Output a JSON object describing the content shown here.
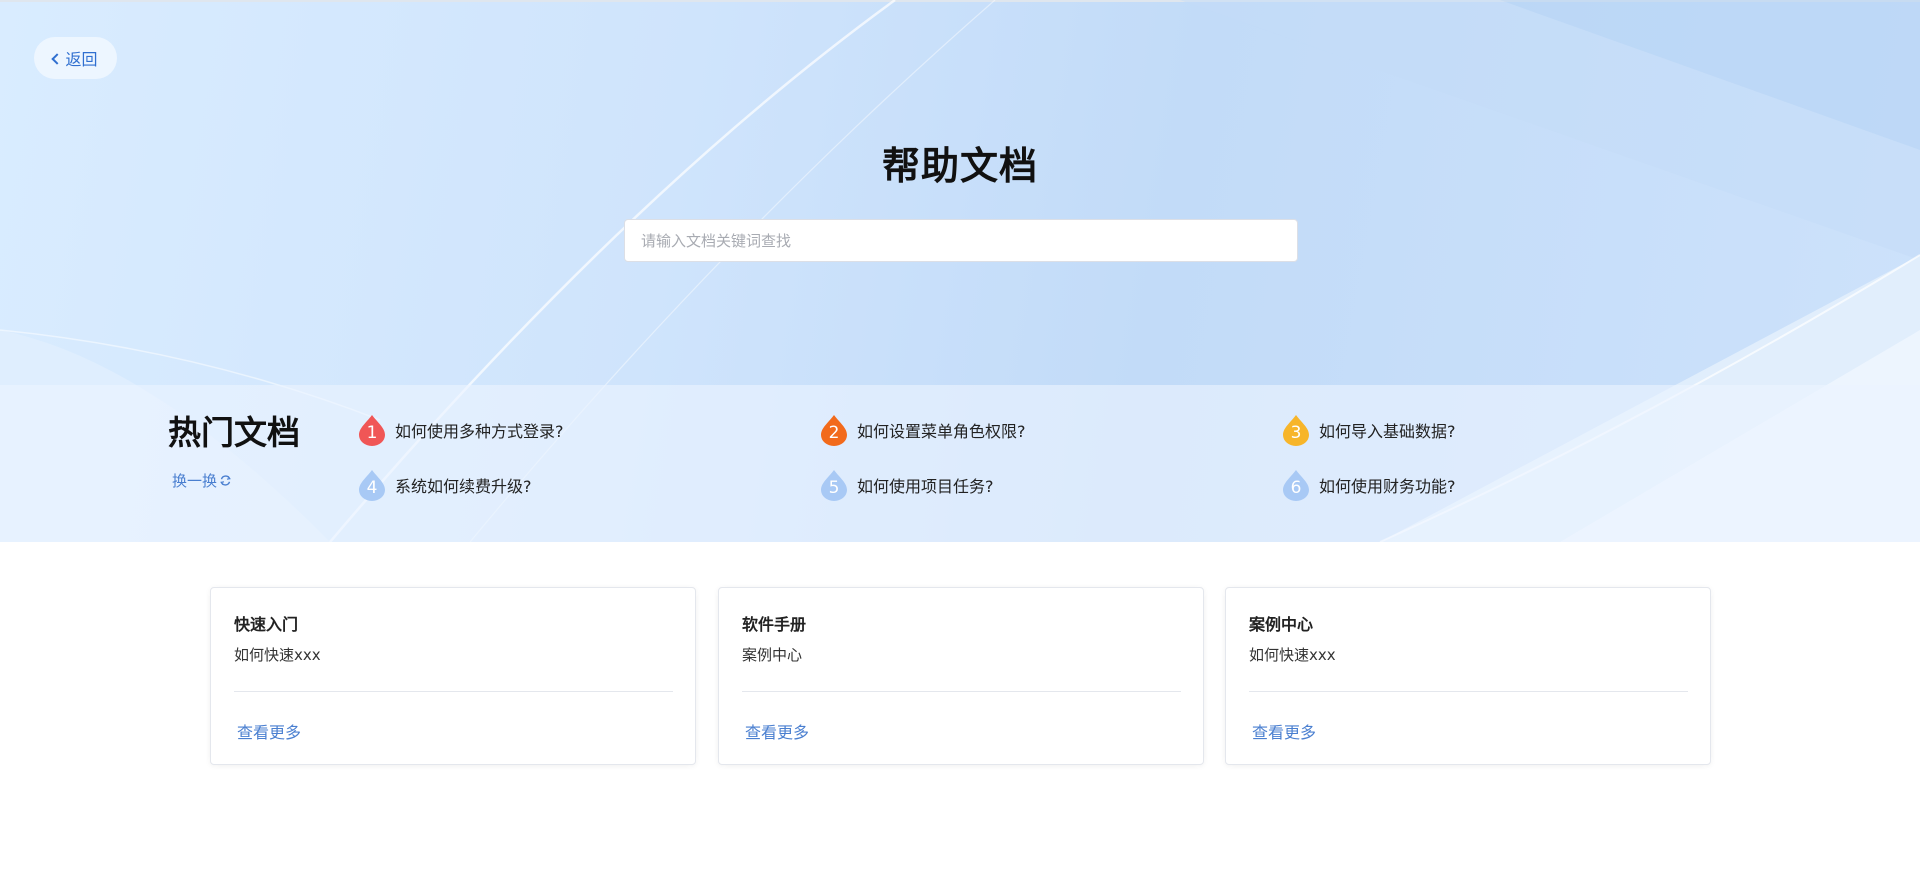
{
  "header": {
    "back_label": "返回",
    "title": "帮助文档"
  },
  "search": {
    "placeholder": "请输入文档关键词查找",
    "value": ""
  },
  "hot_docs": {
    "title": "热门文档",
    "refresh_label": "换一换",
    "items": [
      {
        "rank": "1",
        "label": "如何使用多种方式登录?",
        "color": "#f05656"
      },
      {
        "rank": "2",
        "label": "如何设置菜单角色权限?",
        "color": "#f26a1b"
      },
      {
        "rank": "3",
        "label": "如何导入基础数据?",
        "color": "#f7b52a"
      },
      {
        "rank": "4",
        "label": "系统如何续费升级?",
        "color": "#a8c9f5"
      },
      {
        "rank": "5",
        "label": "如何使用项目任务?",
        "color": "#a8c9f5"
      },
      {
        "rank": "6",
        "label": "如何使用财务功能?",
        "color": "#a8c9f5"
      }
    ]
  },
  "cards": [
    {
      "title": "快速入门",
      "desc": "如何快速xxx",
      "more_label": "查看更多"
    },
    {
      "title": "软件手册",
      "desc": "案例中心",
      "more_label": "查看更多"
    },
    {
      "title": "案例中心",
      "desc": "如何快速xxx",
      "more_label": "查看更多"
    }
  ],
  "colors": {
    "accent": "#4a7fd0",
    "hero_bg": "#cfe4fc"
  }
}
